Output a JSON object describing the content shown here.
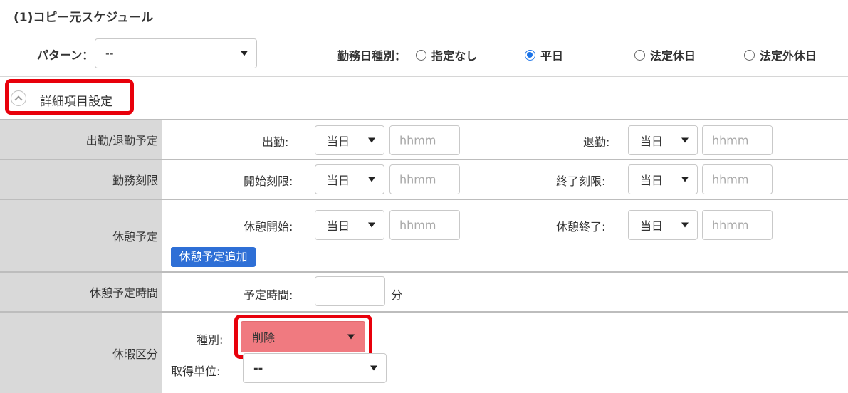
{
  "title": "(1)コピー元スケジュール",
  "pattern": {
    "label": "パターン：",
    "value": "--"
  },
  "kinmu_type": {
    "label": "勤務日種別：",
    "options": [
      {
        "label": "指定なし",
        "selected": false
      },
      {
        "label": "平日",
        "selected": true
      },
      {
        "label": "法定休日",
        "selected": false
      },
      {
        "label": "法定外休日",
        "selected": false
      }
    ]
  },
  "detail_toggle": {
    "label": "詳細項目設定",
    "icon": "chevron-up-icon"
  },
  "rows": {
    "attendance": {
      "header": "出勤/退勤予定",
      "start_label": "出勤:",
      "start_day": "当日",
      "start_time_placeholder": "hhmm",
      "end_label": "退勤:",
      "end_day": "当日",
      "end_time_placeholder": "hhmm"
    },
    "limit": {
      "header": "勤務刻限",
      "start_label": "開始刻限:",
      "start_day": "当日",
      "start_time_placeholder": "hhmm",
      "end_label": "終了刻限:",
      "end_day": "当日",
      "end_time_placeholder": "hhmm"
    },
    "break": {
      "header": "休憩予定",
      "start_label": "休憩開始:",
      "start_day": "当日",
      "start_time_placeholder": "hhmm",
      "end_label": "休憩終了:",
      "end_day": "当日",
      "end_time_placeholder": "hhmm",
      "add_button": "休憩予定追加"
    },
    "break_time": {
      "header": "休憩予定時間",
      "label": "予定時間:",
      "value": "",
      "unit": "分"
    },
    "leave": {
      "header": "休暇区分",
      "type_label": "種別:",
      "type_value": "削除",
      "unit_label": "取得単位:",
      "unit_value": "--"
    }
  },
  "colors": {
    "highlight": "#e8000b",
    "accent": "#2e6fd6",
    "delete_select": "#f07a80",
    "header_bg": "#d9d9d9"
  }
}
